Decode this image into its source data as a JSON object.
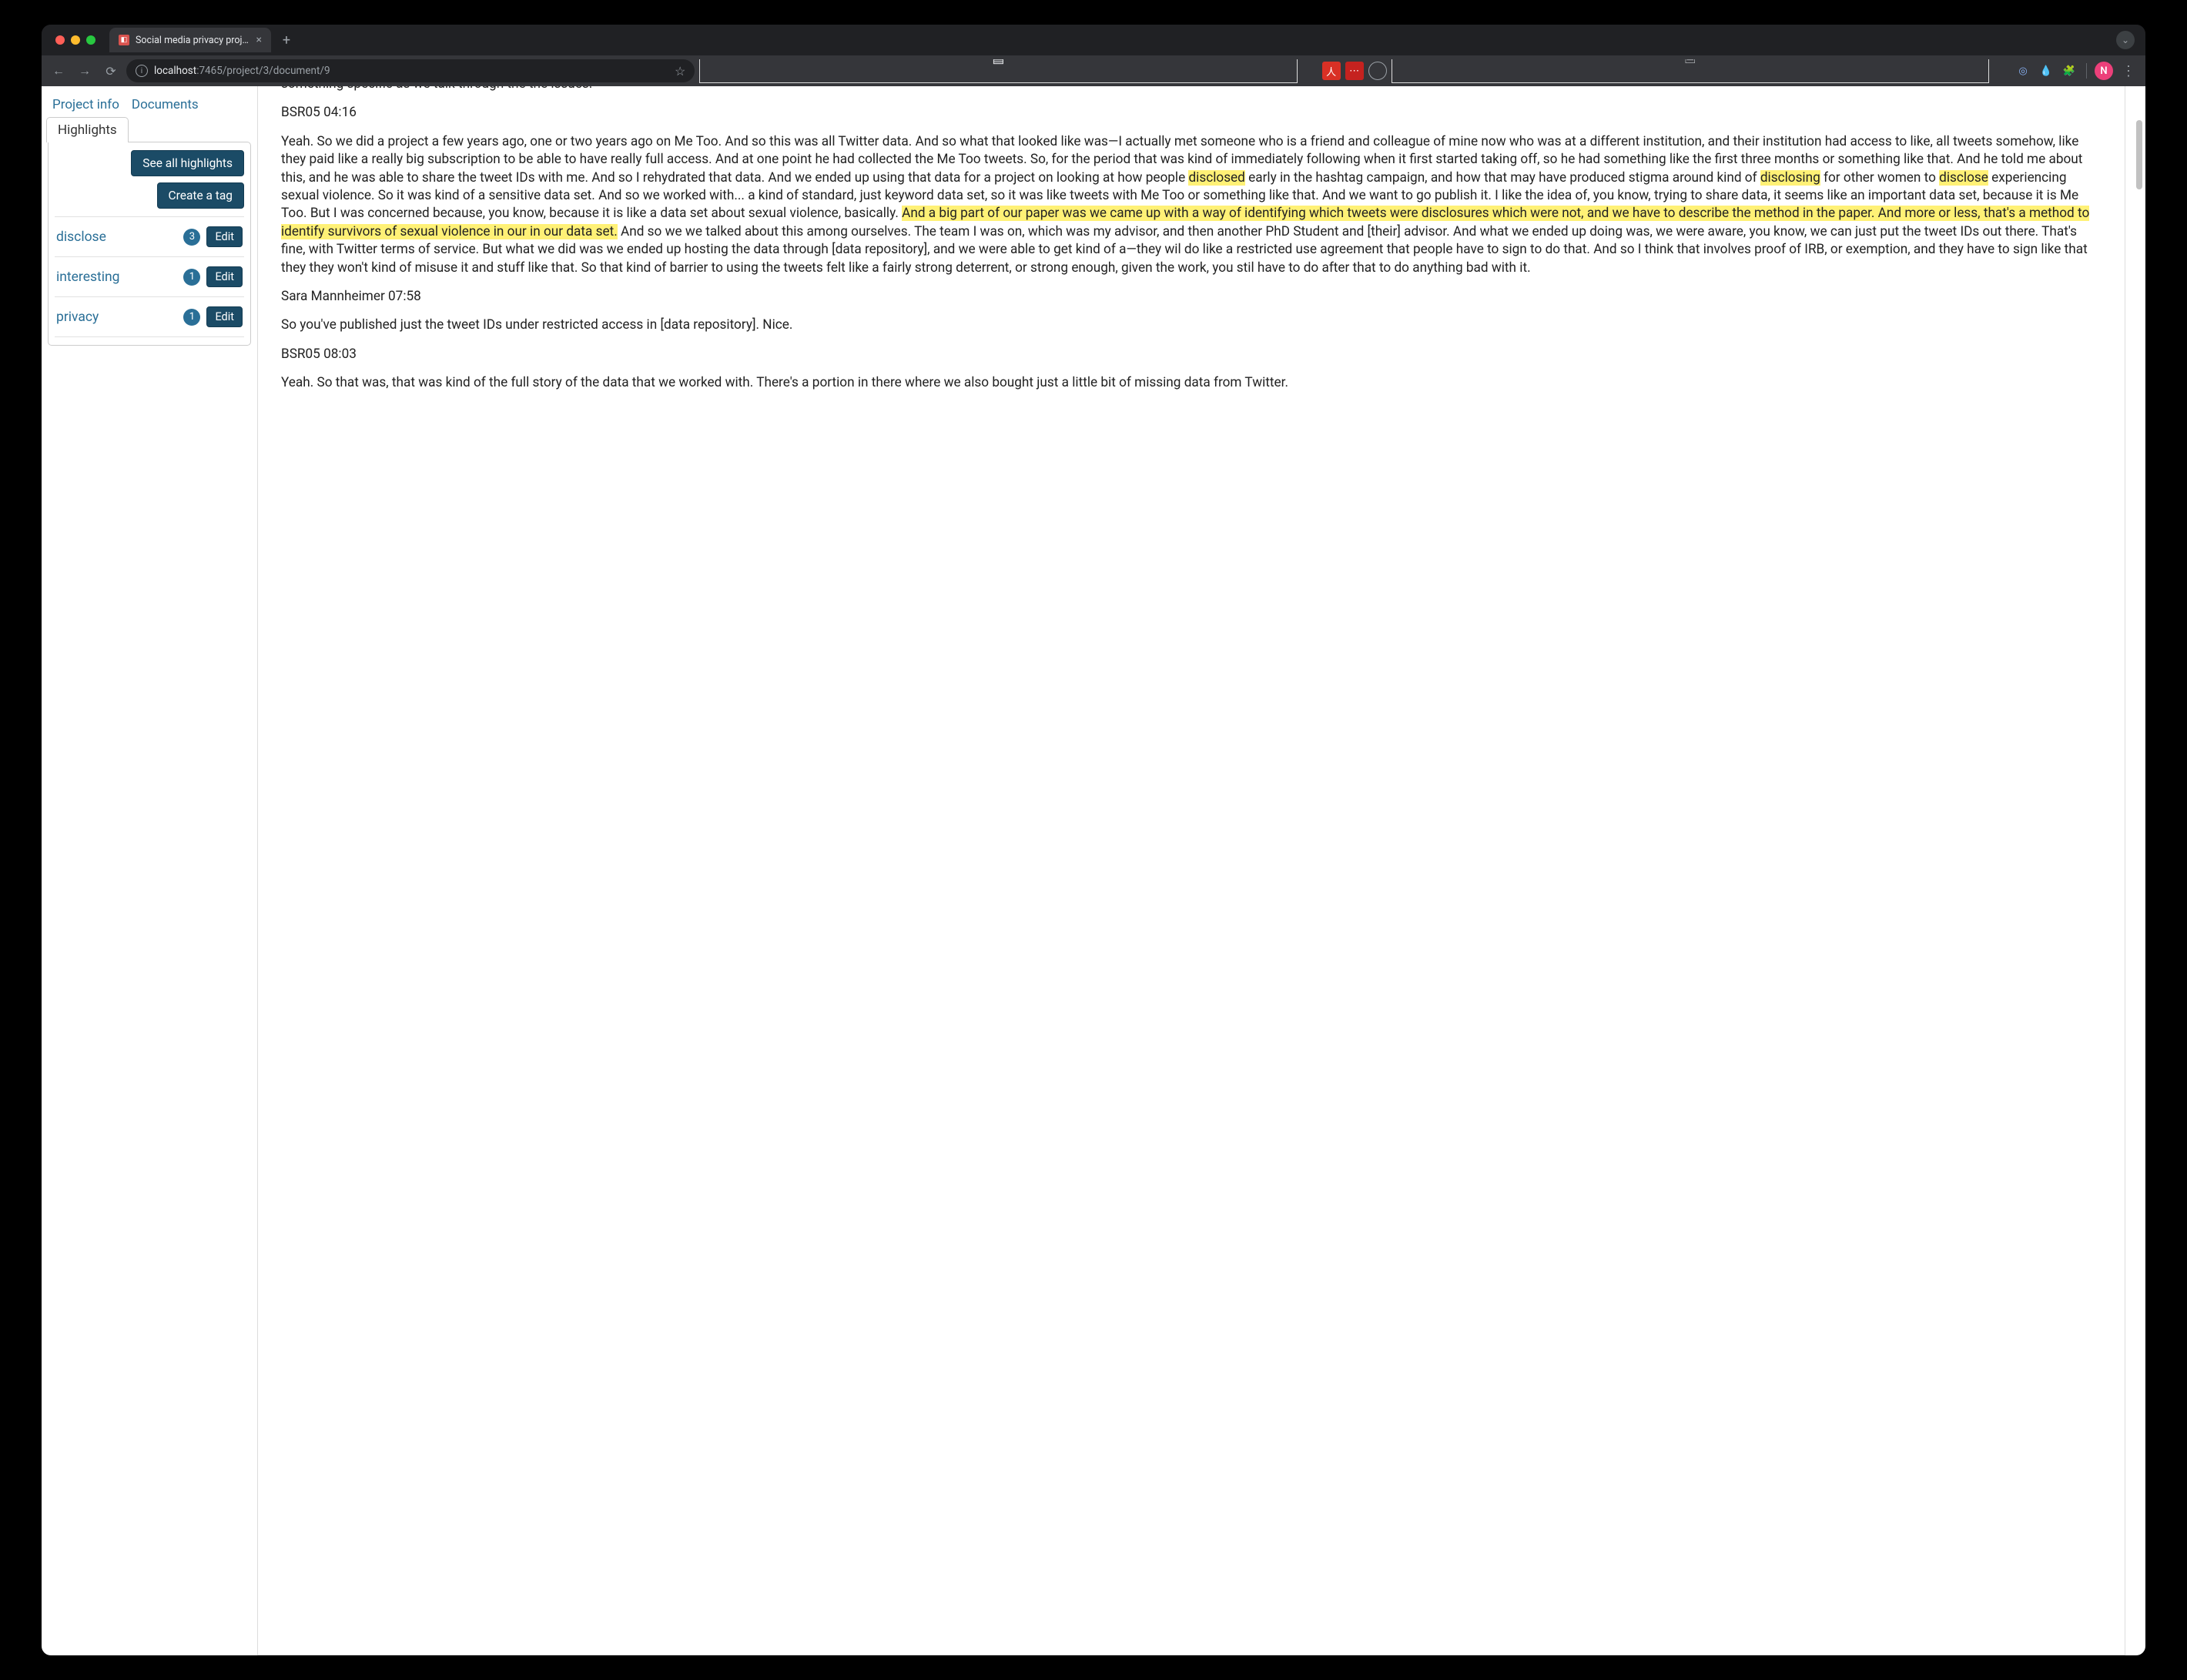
{
  "browser": {
    "tab_title": "Social media privacy project p",
    "url_host": "localhost",
    "url_port": ":7465",
    "url_path": "/project/3/document/9",
    "avatar_initial": "N"
  },
  "sidebar": {
    "tabs": {
      "project_info": "Project info",
      "documents": "Documents"
    },
    "highlights_label": "Highlights",
    "actions": {
      "see_all": "See all highlights",
      "create_tag": "Create a tag"
    },
    "tags": [
      {
        "name": "disclose",
        "count": "3",
        "edit": "Edit"
      },
      {
        "name": "interesting",
        "count": "1",
        "edit": "Edit"
      },
      {
        "name": "privacy",
        "count": "1",
        "edit": "Edit"
      }
    ]
  },
  "document": {
    "partial_top": "something specific as we talk through the the issues.",
    "speaker1": "BSR05 04:16",
    "p1a": "Yeah. So we did a project a few years ago, one or two years ago on Me Too. And so this was all Twitter data. And so what that looked like was—I actually met someone who is a friend and colleague of mine now who was at a different institution, and their institution had access to like, all tweets somehow, like they paid like a really big subscription to be able to have really full access. And at one point he had collected the Me Too tweets. So, for the period that was kind of immediately following when it first started taking off, so he had something like the first three months or something like that. And he told me about this, and he was able to share the tweet IDs with me. And so I rehydrated that data. And we ended up using that data for a project on looking at how people ",
    "h1": "disclosed",
    "p1b": " early in the hashtag campaign, and how that may have produced stigma around kind of ",
    "h2": "disclosing",
    "p1c": " for other women to ",
    "h3": "disclose",
    "p1d": " experiencing sexual violence. So it was kind of a sensitive data set. And so we worked with... a kind of standard, just keyword data set, so it was like tweets with Me Too or something like that. And we want to go publish it. I like the idea of, you know, trying to share data, it seems like an important data set, because it is Me Too. But I was concerned because, you know, because it is like a data set about sexual violence, basically. ",
    "h4": "And a big part of our paper was we came up with a way of identifying which tweets were disclosures which were not, and we have to describe the method in the paper. And more or less, that's a method to identify survivors of sexual violence in our in our data set.",
    "p1e": " And so we we talked about this among ourselves. The team I was on, which was my advisor, and then another PhD Student and [their] advisor. And what we ended up doing was, we were aware, you know, we can just put the tweet IDs out there. That's fine, with Twitter terms of service. But what we did was we ended up hosting the data through [data repository], and we were able to get kind of a—they wil do like a restricted use agreement that people have to sign to do that. And so I think that involves proof of IRB, or exemption, and they have to sign like that they they won't kind of misuse it and stuff like that. So that kind of barrier to using the tweets felt like a fairly strong deterrent, or strong enough, given the work, you stil have to do after that to do anything bad with it.",
    "speaker2": "Sara Mannheimer 07:58",
    "p2": "So you've published just the tweet IDs under restricted access in [data repository]. Nice.",
    "speaker3": "BSR05 08:03",
    "p3": "Yeah. So that was, that was kind of the full story of the data that we worked with. There's a portion in there where we also bought just a little bit of missing data from Twitter."
  }
}
